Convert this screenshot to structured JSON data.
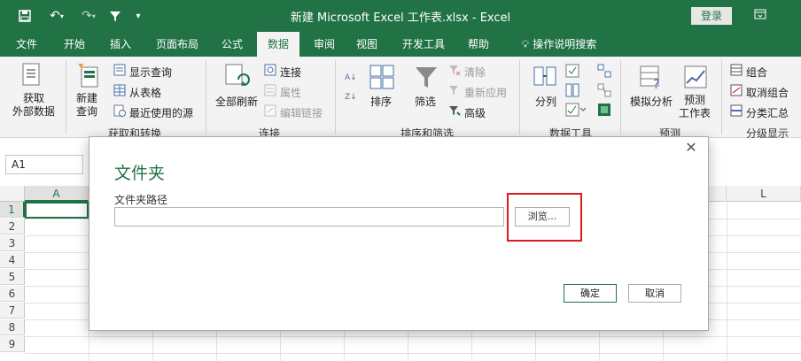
{
  "window": {
    "title": "新建 Microsoft Excel 工作表.xlsx  -  Excel",
    "login_label": "登录",
    "icons": [
      "save-icon",
      "undo-icon",
      "redo-icon",
      "filter-icon",
      "customize-icon",
      "ribbon-display-icon"
    ]
  },
  "tabs": [
    {
      "label": "文件"
    },
    {
      "label": "开始"
    },
    {
      "label": "插入"
    },
    {
      "label": "页面布局"
    },
    {
      "label": "公式"
    },
    {
      "label": "数据"
    },
    {
      "label": "审阅"
    },
    {
      "label": "视图"
    },
    {
      "label": "开发工具"
    },
    {
      "label": "帮助"
    },
    {
      "label": "操作说明搜索"
    }
  ],
  "ribbon": {
    "get_external_data": "获取\n外部数据",
    "new_query": "新建\n查询",
    "show_queries": "显示查询",
    "from_table": "从表格",
    "recent_sources": "最近使用的源",
    "group_get_transform": "获取和转换",
    "refresh_all": "全部刷新",
    "connections": "连接",
    "properties": "属性",
    "edit_links": "编辑链接",
    "group_connections": "连接",
    "sort": "排序",
    "filter": "筛选",
    "clear": "清除",
    "reapply": "重新应用",
    "advanced": "高级",
    "group_sort_filter": "排序和筛选",
    "text_to_columns": "分列",
    "group_data_tools": "数据工具",
    "what_if": "模拟分析",
    "forecast_sheet": "预测\n工作表",
    "group_forecast": "预测",
    "group": "组合",
    "ungroup": "取消组合",
    "subtotal": "分类汇总",
    "group_outline": "分级显示"
  },
  "formula_bar": {
    "name_box": "A1"
  },
  "grid": {
    "visible_columns": [
      "A",
      "L"
    ],
    "rows": [
      "1",
      "2",
      "3",
      "4",
      "5",
      "6",
      "7",
      "8",
      "9"
    ]
  },
  "dialog": {
    "title": "文件夹",
    "path_label": "文件夹路径",
    "path_value": "",
    "browse_label": "浏览...",
    "ok_label": "确定",
    "cancel_label": "取消"
  }
}
